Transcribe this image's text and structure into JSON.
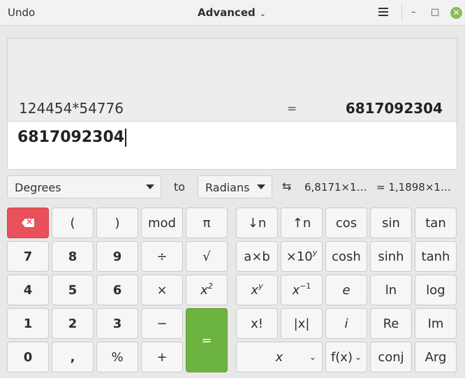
{
  "header": {
    "undo_label": "Undo",
    "mode_label": "Advanced",
    "minimize_glyph": "–",
    "maximize_glyph": "□",
    "close_glyph": "✕"
  },
  "display": {
    "history_expression": "124454*54776",
    "history_equals": "=",
    "history_result": "6817092304",
    "entry_value": "6817092304"
  },
  "conversion": {
    "from_unit": "Degrees",
    "to_label": "to",
    "to_unit": "Radians",
    "swap_glyph": "⇆",
    "from_value": "6,8171×1…",
    "to_value": "= 1,1898×1…"
  },
  "keypad": {
    "basic": [
      [
        "⌫",
        "(",
        ")",
        "mod",
        "π"
      ],
      [
        "7",
        "8",
        "9",
        "÷",
        "√"
      ],
      [
        "4",
        "5",
        "6",
        "×",
        "x²"
      ],
      [
        "1",
        "2",
        "3",
        "−",
        "="
      ],
      [
        "0",
        ",",
        "%",
        "+"
      ]
    ],
    "labels": {
      "lparen": "(",
      "rparen": ")",
      "mod": "mod",
      "pi": "π",
      "seven": "7",
      "eight": "8",
      "nine": "9",
      "divide": "÷",
      "sqrt": "√",
      "four": "4",
      "five": "5",
      "six": "6",
      "multiply": "×",
      "x_base": "x",
      "x_sup2": "2",
      "one": "1",
      "two": "2",
      "three": "3",
      "minus": "−",
      "equals": "=",
      "zero": "0",
      "comma": ",",
      "percent": "%",
      "plus": "+",
      "down_n": "↓n",
      "up_n": "↑n",
      "cos": "cos",
      "sin": "sin",
      "tan": "tan",
      "axb": "a×b",
      "ten_base": "×10",
      "ten_sup": "y",
      "cosh": "cosh",
      "sinh": "sinh",
      "tanh": "tanh",
      "xy_base": "x",
      "xy_sup": "y",
      "xinv_base": "x",
      "xinv_sup": "−1",
      "e": "e",
      "ln": "ln",
      "log": "log",
      "factorial": "x!",
      "abs": "|x|",
      "i": "i",
      "re": "Re",
      "im": "Im",
      "var_x": "x",
      "fx": "f(x)",
      "conj": "conj",
      "arg": "Arg"
    }
  },
  "colors": {
    "backspace": "#e8505b",
    "equals": "#6db33f",
    "close": "#8cbb56"
  }
}
